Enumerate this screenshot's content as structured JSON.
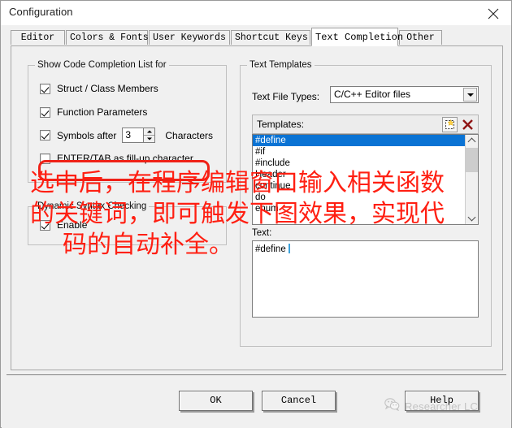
{
  "window": {
    "title": "Configuration",
    "close_icon": "close-icon"
  },
  "tabs": [
    {
      "label": "Editor",
      "active": false
    },
    {
      "label": "Colors & Fonts",
      "active": false
    },
    {
      "label": "User Keywords",
      "active": false
    },
    {
      "label": "Shortcut Keys",
      "active": false
    },
    {
      "label": "Text Completion",
      "active": true
    },
    {
      "label": "Other",
      "active": false
    }
  ],
  "completion_group": {
    "title": "Show Code Completion List for",
    "items": [
      {
        "label": "Struct / Class Members",
        "checked": true
      },
      {
        "label": "Function Parameters",
        "checked": true
      },
      {
        "label": "Symbols after",
        "checked": true
      },
      {
        "label": "ENTER/TAB as fill-up character",
        "checked": false
      }
    ],
    "symbols_after_value": "3",
    "symbols_after_suffix": "Characters"
  },
  "syntax_group": {
    "title": "Dynamic Syntax Checking",
    "enable_label": "Enable",
    "enable_checked": true
  },
  "templates_group": {
    "title": "Text Templates",
    "file_types_label": "Text File Types:",
    "file_types_value": "C/C++ Editor files",
    "templates_label": "Templates:",
    "new_icon": "new-template-icon",
    "delete_icon": "delete-template-icon",
    "list": [
      {
        "label": "#define",
        "selected": true
      },
      {
        "label": "#if",
        "selected": false
      },
      {
        "label": "#include",
        "selected": false
      },
      {
        "label": "Header",
        "selected": false
      },
      {
        "label": "continue",
        "selected": false
      },
      {
        "label": "do",
        "selected": false
      },
      {
        "label": "enum",
        "selected": false
      }
    ],
    "text_label": "Text:",
    "text_value": "#define "
  },
  "buttons": {
    "ok": "OK",
    "cancel": "Cancel",
    "help": "Help"
  },
  "annotation": {
    "line1": "选中后，在程序编辑窗口输入相关函数",
    "line2": "的关键词，即可触发下图效果，实现代",
    "line3": "码的自动补全。",
    "color": "#ff1f12"
  },
  "watermark": {
    "text": "Researcher LC",
    "icon": "wechat-icon"
  },
  "colors": {
    "selection_blue": "#0a73d4",
    "highlight_red": "#ef2117",
    "dialog_bg": "#f0f0f0"
  }
}
